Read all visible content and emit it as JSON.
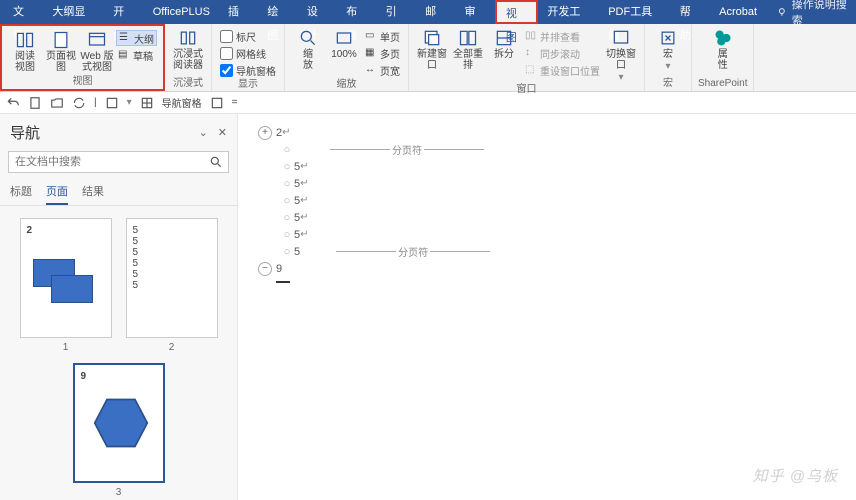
{
  "menubar": {
    "items": [
      "文件",
      "大纲显示",
      "开始",
      "OfficePLUS",
      "插入",
      "绘图",
      "设计",
      "布局",
      "引用",
      "邮件",
      "审阅",
      "视图",
      "开发工具",
      "PDF工具箱",
      "帮助",
      "Acrobat"
    ],
    "active_index": 11,
    "tell_me": "操作说明搜索"
  },
  "ribbon": {
    "views": {
      "label": "视图",
      "read": "阅读\n视图",
      "page": "页面视图",
      "web": "Web 版式视图",
      "outline": "大纲",
      "draft": "草稿"
    },
    "immersive": {
      "label": "沉浸式",
      "reader": "沉浸式\n阅读器"
    },
    "show": {
      "label": "显示",
      "ruler": "标尺",
      "gridlines": "网格线",
      "navpane": "导航窗格"
    },
    "zoom": {
      "label": "缩放",
      "zoom": "缩\n放",
      "hundred": "100%",
      "one_page": "单页",
      "multi_page": "多页",
      "page_width": "页宽"
    },
    "window": {
      "label": "窗口",
      "new": "新建窗口",
      "arrange": "全部重排",
      "split": "拆分",
      "side": "并排查看",
      "sync": "同步滚动",
      "reset": "重设窗口位置",
      "switch": "切换窗口"
    },
    "macros": {
      "label": "宏",
      "btn": "宏"
    },
    "sharepoint": {
      "label": "SharePoint",
      "btn": "属\n性"
    }
  },
  "qat": {
    "navpane": "导航窗格"
  },
  "nav": {
    "title": "导航",
    "search_placeholder": "在文档中搜索",
    "tabs": [
      "标题",
      "页面",
      "结果"
    ],
    "active_tab": 1,
    "pages": [
      {
        "num": "1",
        "first": "2"
      },
      {
        "num": "2",
        "lines": [
          "5",
          "5",
          "5",
          "5",
          "5",
          "5"
        ]
      },
      {
        "num": "3",
        "first": "9",
        "selected": true
      }
    ]
  },
  "doc": {
    "heading1": "2",
    "break_label": "分页符",
    "body_lines": [
      "5",
      "5",
      "5",
      "5",
      "5",
      "5"
    ],
    "heading2": "9"
  },
  "watermark": "知乎 @乌板"
}
